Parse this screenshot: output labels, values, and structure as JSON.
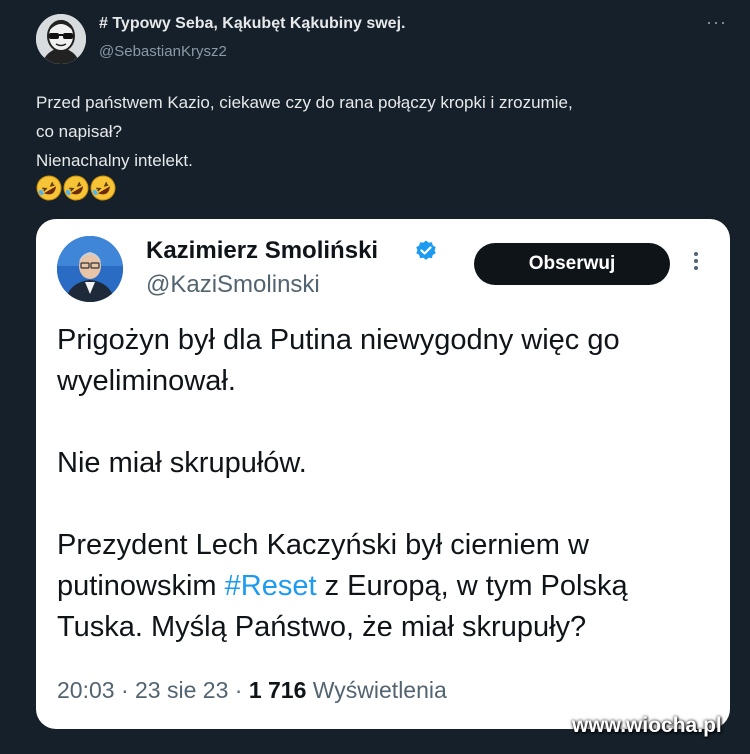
{
  "outer_tweet": {
    "author_name": "# Typowy Seba, Kąkubęt Kąkubiny swej.",
    "author_handle": "@SebastianKrysz2",
    "more_icon": "···",
    "text_lines": [
      "Przed państwem Kazio, ciekawe czy do rana połączy kropki i zrozumie,",
      "co napisał?",
      "Nienachalny intelekt."
    ],
    "emojis": [
      "rolling-on-floor-laughing",
      "rolling-on-floor-laughing",
      "rolling-on-floor-laughing"
    ]
  },
  "quoted_tweet": {
    "author_name": "Kazimierz Smoliński",
    "author_handle": "@KaziSmolinski",
    "follow_label": "Obserwuj",
    "body": {
      "p1": "Prigożyn był dla Putina niewygodny więc go wyeliminował.",
      "p2": "Nie miał skrupułów.",
      "p3_before": "Prezydent Lech Kaczyński był cierniem w putinowskim ",
      "p3_hashtag": "#Reset",
      "p3_after": " z Europą, w tym Polską Tuska. Myślą Państwo, że miał skrupuły?"
    },
    "meta": {
      "time": "20:03",
      "sep1": " · ",
      "date": "23 sie 23",
      "sep2": " · ",
      "views": "1 716",
      "views_label": " Wyświetlenia"
    }
  },
  "watermark": "www.wiocha.pl",
  "colors": {
    "background": "#15202b",
    "text_light": "#e7e9ea",
    "text_muted": "#8b98a5",
    "card_bg": "#ffffff",
    "hashtag": "#1d9bf0",
    "button_bg": "#0f1419"
  }
}
